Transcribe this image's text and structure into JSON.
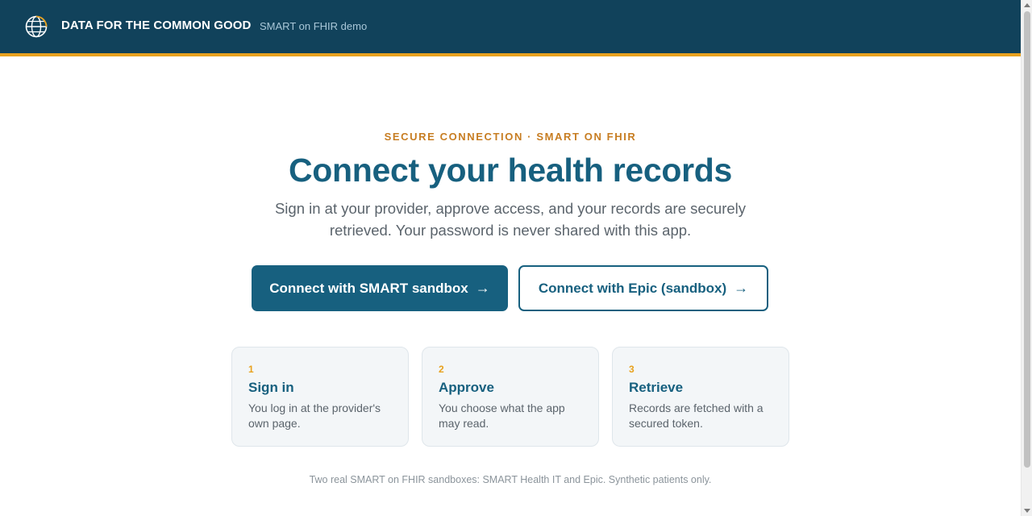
{
  "header": {
    "logo_icon": "globe-icon",
    "brand": "DATA FOR THE COMMON GOOD",
    "subtitle": "SMART on FHIR demo",
    "bg_color": "#11425b",
    "accent_color": "#e8a11e"
  },
  "hero": {
    "eyebrow": "SECURE CONNECTION · SMART ON FHIR",
    "title": "Connect your health records",
    "description": "Sign in at your provider, approve access, and your records are securely retrieved. Your password is never shared with this app."
  },
  "buttons": {
    "smart": {
      "label": "Connect with SMART sandbox",
      "arrow": "→"
    },
    "epic": {
      "label": "Connect with Epic (sandbox)",
      "arrow": "→"
    }
  },
  "steps": [
    {
      "number": "1",
      "title": "Sign in",
      "text": "You log in at the provider's own page."
    },
    {
      "number": "2",
      "title": "Approve",
      "text": "You choose what the app may read."
    },
    {
      "number": "3",
      "title": "Retrieve",
      "text": "Records are fetched with a secured token."
    }
  ],
  "footnote": "Two real SMART on FHIR sandboxes: SMART Health IT and Epic. Synthetic patients only."
}
